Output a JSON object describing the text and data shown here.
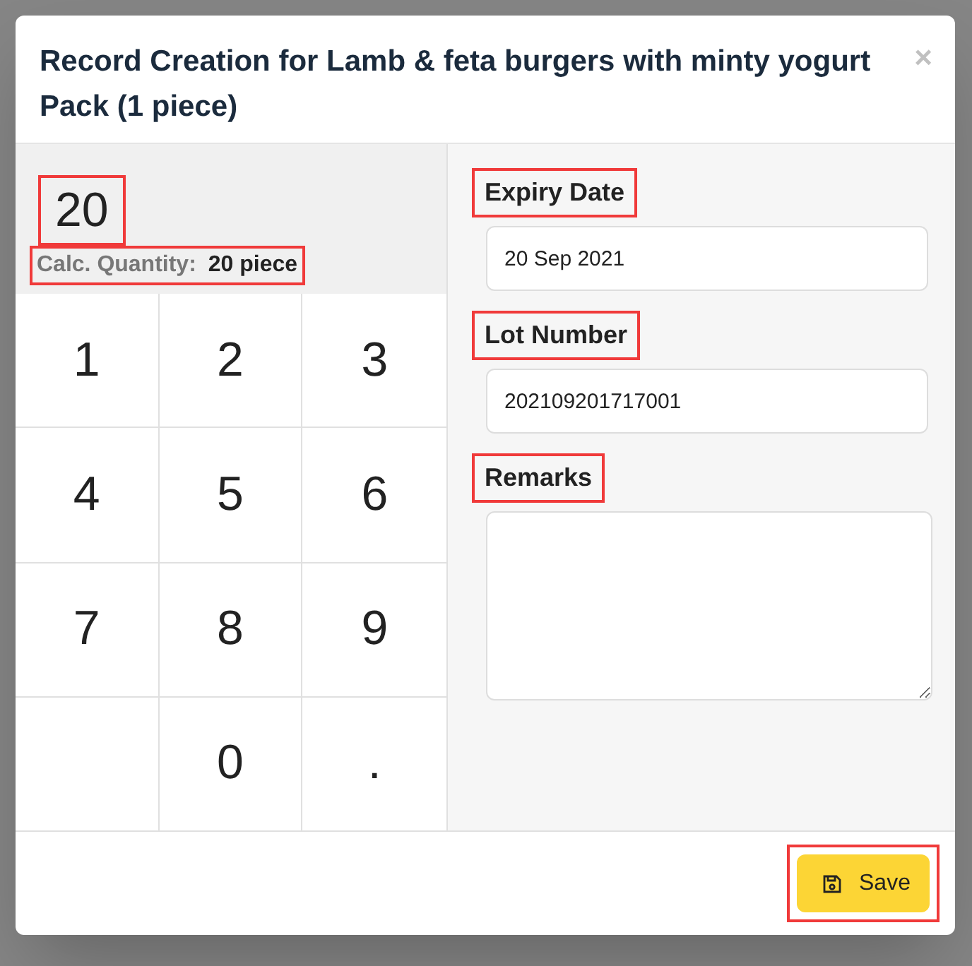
{
  "dialog": {
    "title": "Record Creation for Lamb & feta burgers with minty yogurt Pack (1 piece)",
    "close": "×"
  },
  "display": {
    "value": "20",
    "value_highlighted": true,
    "calc_label": "Calc. Quantity:",
    "calc_value": "20 piece",
    "calc_highlighted": true
  },
  "keypad": [
    {
      "kind": "key",
      "label": "1"
    },
    {
      "kind": "key",
      "label": "2"
    },
    {
      "kind": "key",
      "label": "3"
    },
    {
      "kind": "key",
      "label": "4"
    },
    {
      "kind": "key",
      "label": "5"
    },
    {
      "kind": "key",
      "label": "6"
    },
    {
      "kind": "key",
      "label": "7"
    },
    {
      "kind": "key",
      "label": "8"
    },
    {
      "kind": "key",
      "label": "9"
    },
    {
      "kind": "blank"
    },
    {
      "kind": "key",
      "label": "0"
    },
    {
      "kind": "key",
      "label": "."
    }
  ],
  "fields": [
    {
      "kind": "input",
      "label": "Expiry Date",
      "value": "20 Sep 2021",
      "highlighted": true
    },
    {
      "kind": "input",
      "label": "Lot Number",
      "value": "202109201717001",
      "highlighted": true
    },
    {
      "kind": "textarea",
      "label": "Remarks",
      "highlighted": true
    }
  ],
  "save_button": {
    "label": "Save",
    "highlighted": true
  }
}
